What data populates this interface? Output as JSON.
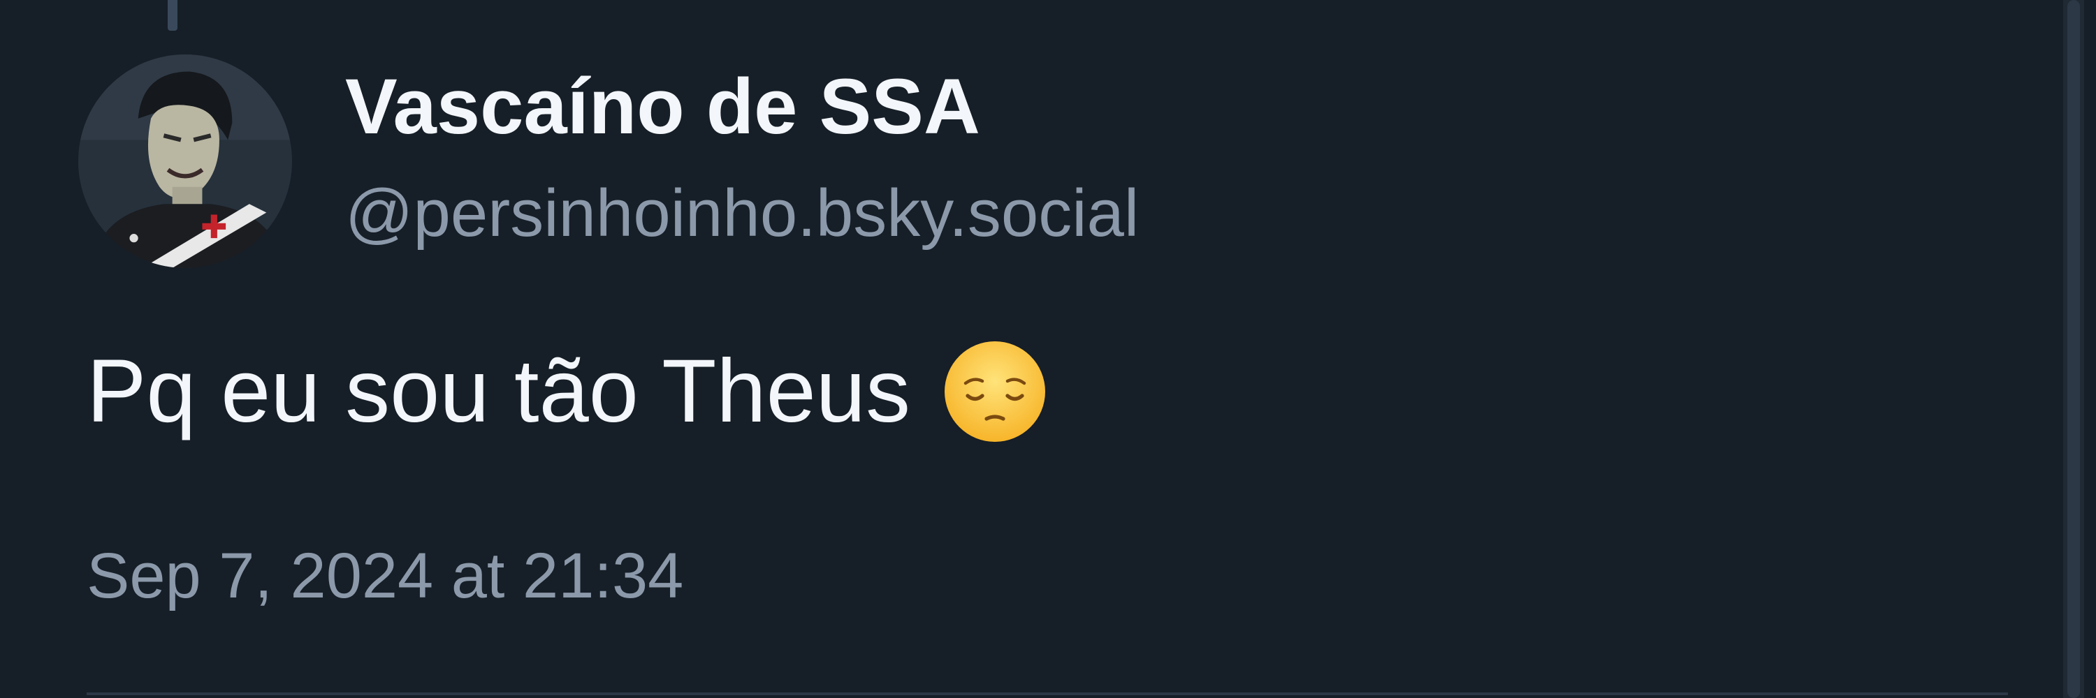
{
  "post": {
    "author": {
      "display_name": "Vascaíno de SSA",
      "handle": "@persinhoinho.bsky.social",
      "avatar_icon": "avatar-character-icon"
    },
    "text": "Pq eu sou tão Theus",
    "emoji_icon": "pensive-face-emoji-icon",
    "timestamp": "Sep 7, 2024 at 21:34"
  },
  "colors": {
    "background": "#161e27",
    "primary_text": "#f3f6fa",
    "secondary_text": "#8b99aa",
    "divider": "#2c3845"
  }
}
